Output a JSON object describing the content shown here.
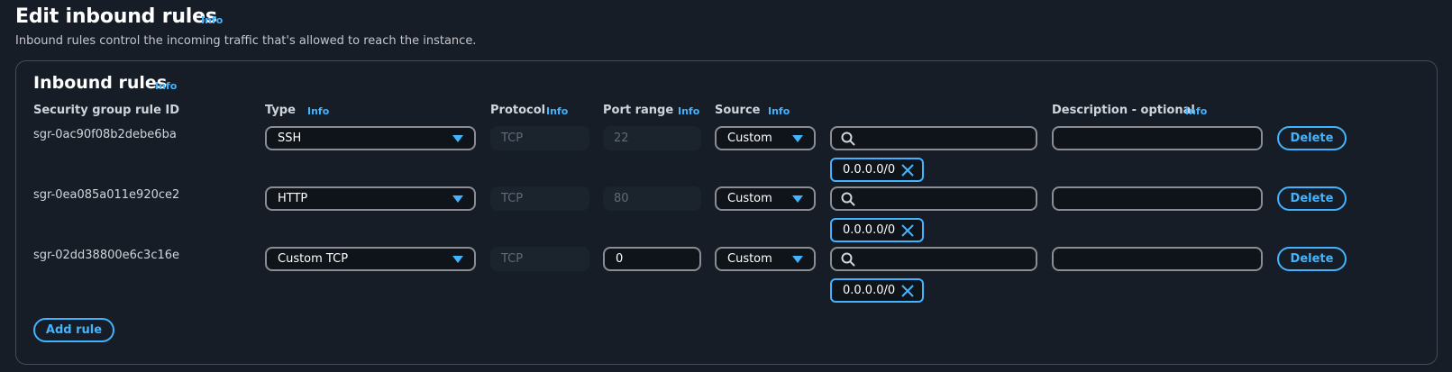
{
  "header": {
    "title": "Edit inbound rules",
    "info": "Info",
    "description": "Inbound rules control the incoming traffic that's allowed to reach the instance."
  },
  "section": {
    "title": "Inbound rules",
    "info": "Info"
  },
  "columns": {
    "rule_id": "Security group rule ID",
    "type": "Type",
    "type_info": "Info",
    "protocol": "Protocol",
    "protocol_info": "Info",
    "port_range": "Port range",
    "port_range_info": "Info",
    "source": "Source",
    "source_info": "Info",
    "description": "Description - optional",
    "description_info": "Info"
  },
  "rules": [
    {
      "id": "sgr-0ac90f08b2debe6ba",
      "type": "SSH",
      "protocol": "TCP",
      "port": "22",
      "port_editable": false,
      "source": "Custom",
      "source_search": "",
      "token": "0.0.0.0/0",
      "description": "",
      "delete_label": "Delete"
    },
    {
      "id": "sgr-0ea085a011e920ce2",
      "type": "HTTP",
      "protocol": "TCP",
      "port": "80",
      "port_editable": false,
      "source": "Custom",
      "source_search": "",
      "token": "0.0.0.0/0",
      "description": "",
      "delete_label": "Delete"
    },
    {
      "id": "sgr-02dd38800e6c3c16e",
      "type": "Custom TCP",
      "protocol": "TCP",
      "port": "0",
      "port_editable": true,
      "source": "Custom",
      "source_search": "",
      "token": "0.0.0.0/0",
      "description": "",
      "delete_label": "Delete"
    }
  ],
  "add_rule_label": "Add rule",
  "icons": {
    "caret": "caret-down-icon",
    "search": "search-icon",
    "remove": "close-icon"
  },
  "colors": {
    "background": "#161d26",
    "accent": "#42b4ff",
    "border": "#8c8c94",
    "disabled_text": "#5f6b7a"
  }
}
